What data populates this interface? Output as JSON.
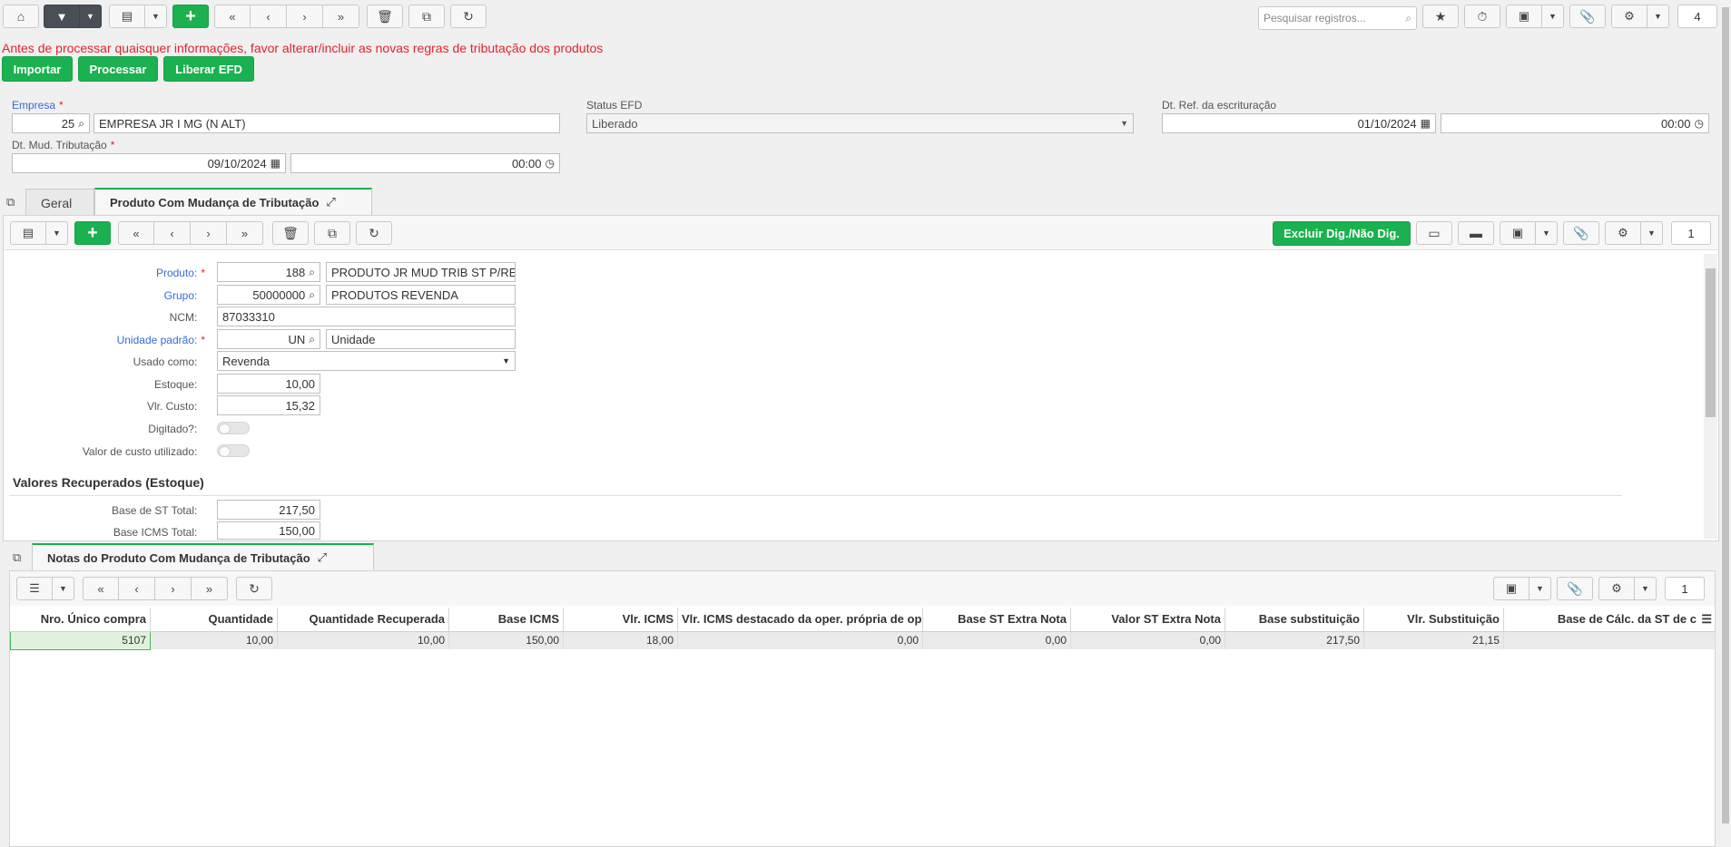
{
  "toolbar": {
    "search_placeholder": "Pesquisar registros...",
    "record_count": "4",
    "icons": [
      "home-icon",
      "filter-icon",
      "grid-icon",
      "add-icon",
      "first-icon",
      "prev-icon",
      "next-icon",
      "last-icon",
      "delete-icon",
      "copy-icon",
      "refresh-icon",
      "star-icon",
      "timer-icon",
      "export-icon",
      "attach-icon",
      "gear-icon"
    ]
  },
  "warning": "Antes de processar quaisquer informações, favor alterar/incluir as novas regras de tributação dos produtos",
  "actions": {
    "importar": "Importar",
    "processar": "Processar",
    "liberar": "Liberar EFD"
  },
  "header": {
    "empresa_label": "Empresa",
    "empresa_code": "25",
    "empresa_name": "EMPRESA JR I MG (N ALT)",
    "status_label": "Status EFD",
    "status_value": "Liberado",
    "dt_ref_label": "Dt. Ref. da escrituração",
    "dt_ref_date": "01/10/2024",
    "dt_ref_time": "00:00",
    "dt_mud_label": "Dt. Mud. Tributação",
    "dt_mud_date": "09/10/2024",
    "dt_mud_time": "00:00"
  },
  "tabs": {
    "geral": "Geral",
    "produto": "Produto Com Mudança de Tributação"
  },
  "detail_toolbar": {
    "excluir": "Excluir Dig./Não Dig.",
    "count": "1"
  },
  "form": {
    "produto_label": "Produto:",
    "produto_code": "188",
    "produto_desc": "PRODUTO JR MUD TRIB ST P/RE",
    "grupo_label": "Grupo:",
    "grupo_code": "50000000",
    "grupo_desc": "PRODUTOS REVENDA",
    "ncm_label": "NCM:",
    "ncm_value": "87033310",
    "unidade_label": "Unidade padrão:",
    "unidade_code": "UN",
    "unidade_desc": "Unidade",
    "usado_label": "Usado como:",
    "usado_value": "Revenda",
    "estoque_label": "Estoque:",
    "estoque_value": "10,00",
    "custo_label": "Vlr. Custo:",
    "custo_value": "15,32",
    "digitado_label": "Digitado?:",
    "valor_custo_label": "Valor de custo utilizado:",
    "section_title": "Valores Recuperados (Estoque)",
    "base_st_label": "Base de ST Total:",
    "base_st_value": "217,50",
    "base_icms_label": "Base ICMS Total:",
    "base_icms_value": "150,00"
  },
  "notas": {
    "tab_label": "Notas do Produto Com Mudança de Tributação",
    "count": "1",
    "columns": [
      "Nro. Único compra",
      "Quantidade",
      "Quantidade Recuperada",
      "Base ICMS",
      "Vlr. ICMS",
      "Vlr. ICMS destacado da oper. própria de op",
      "Base ST Extra Nota",
      "Valor ST Extra Nota",
      "Base substituição",
      "Vlr. Substituição",
      "Base de Cálc. da ST de c"
    ],
    "rows": [
      [
        "5107",
        "10,00",
        "10,00",
        "150,00",
        "18,00",
        "0,00",
        "0,00",
        "0,00",
        "217,50",
        "21,15",
        ""
      ]
    ]
  }
}
